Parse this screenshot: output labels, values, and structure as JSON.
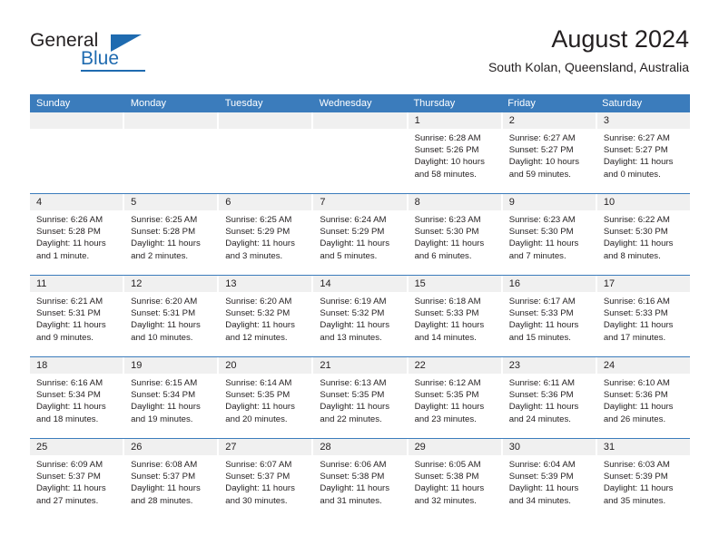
{
  "brand": {
    "name_top": "General",
    "name_bottom": "Blue"
  },
  "header": {
    "title": "August 2024",
    "subtitle": "South Kolan, Queensland, Australia"
  },
  "colors": {
    "header_blue": "#3b7cbc",
    "brand_blue": "#1f6bb0",
    "daynum_band": "#f0f0f0",
    "text": "#231f20"
  },
  "weekdays": [
    "Sunday",
    "Monday",
    "Tuesday",
    "Wednesday",
    "Thursday",
    "Friday",
    "Saturday"
  ],
  "labels": {
    "sunrise_prefix": "Sunrise:",
    "sunset_prefix": "Sunset:",
    "daylight_prefix": "Daylight:"
  },
  "weeks": [
    [
      {
        "day": "",
        "sunrise": "",
        "sunset": "",
        "daylight_line1": "",
        "daylight_line2": ""
      },
      {
        "day": "",
        "sunrise": "",
        "sunset": "",
        "daylight_line1": "",
        "daylight_line2": ""
      },
      {
        "day": "",
        "sunrise": "",
        "sunset": "",
        "daylight_line1": "",
        "daylight_line2": ""
      },
      {
        "day": "",
        "sunrise": "",
        "sunset": "",
        "daylight_line1": "",
        "daylight_line2": ""
      },
      {
        "day": "1",
        "sunrise": "Sunrise: 6:28 AM",
        "sunset": "Sunset: 5:26 PM",
        "daylight_line1": "Daylight: 10 hours",
        "daylight_line2": "and 58 minutes."
      },
      {
        "day": "2",
        "sunrise": "Sunrise: 6:27 AM",
        "sunset": "Sunset: 5:27 PM",
        "daylight_line1": "Daylight: 10 hours",
        "daylight_line2": "and 59 minutes."
      },
      {
        "day": "3",
        "sunrise": "Sunrise: 6:27 AM",
        "sunset": "Sunset: 5:27 PM",
        "daylight_line1": "Daylight: 11 hours",
        "daylight_line2": "and 0 minutes."
      }
    ],
    [
      {
        "day": "4",
        "sunrise": "Sunrise: 6:26 AM",
        "sunset": "Sunset: 5:28 PM",
        "daylight_line1": "Daylight: 11 hours",
        "daylight_line2": "and 1 minute."
      },
      {
        "day": "5",
        "sunrise": "Sunrise: 6:25 AM",
        "sunset": "Sunset: 5:28 PM",
        "daylight_line1": "Daylight: 11 hours",
        "daylight_line2": "and 2 minutes."
      },
      {
        "day": "6",
        "sunrise": "Sunrise: 6:25 AM",
        "sunset": "Sunset: 5:29 PM",
        "daylight_line1": "Daylight: 11 hours",
        "daylight_line2": "and 3 minutes."
      },
      {
        "day": "7",
        "sunrise": "Sunrise: 6:24 AM",
        "sunset": "Sunset: 5:29 PM",
        "daylight_line1": "Daylight: 11 hours",
        "daylight_line2": "and 5 minutes."
      },
      {
        "day": "8",
        "sunrise": "Sunrise: 6:23 AM",
        "sunset": "Sunset: 5:30 PM",
        "daylight_line1": "Daylight: 11 hours",
        "daylight_line2": "and 6 minutes."
      },
      {
        "day": "9",
        "sunrise": "Sunrise: 6:23 AM",
        "sunset": "Sunset: 5:30 PM",
        "daylight_line1": "Daylight: 11 hours",
        "daylight_line2": "and 7 minutes."
      },
      {
        "day": "10",
        "sunrise": "Sunrise: 6:22 AM",
        "sunset": "Sunset: 5:30 PM",
        "daylight_line1": "Daylight: 11 hours",
        "daylight_line2": "and 8 minutes."
      }
    ],
    [
      {
        "day": "11",
        "sunrise": "Sunrise: 6:21 AM",
        "sunset": "Sunset: 5:31 PM",
        "daylight_line1": "Daylight: 11 hours",
        "daylight_line2": "and 9 minutes."
      },
      {
        "day": "12",
        "sunrise": "Sunrise: 6:20 AM",
        "sunset": "Sunset: 5:31 PM",
        "daylight_line1": "Daylight: 11 hours",
        "daylight_line2": "and 10 minutes."
      },
      {
        "day": "13",
        "sunrise": "Sunrise: 6:20 AM",
        "sunset": "Sunset: 5:32 PM",
        "daylight_line1": "Daylight: 11 hours",
        "daylight_line2": "and 12 minutes."
      },
      {
        "day": "14",
        "sunrise": "Sunrise: 6:19 AM",
        "sunset": "Sunset: 5:32 PM",
        "daylight_line1": "Daylight: 11 hours",
        "daylight_line2": "and 13 minutes."
      },
      {
        "day": "15",
        "sunrise": "Sunrise: 6:18 AM",
        "sunset": "Sunset: 5:33 PM",
        "daylight_line1": "Daylight: 11 hours",
        "daylight_line2": "and 14 minutes."
      },
      {
        "day": "16",
        "sunrise": "Sunrise: 6:17 AM",
        "sunset": "Sunset: 5:33 PM",
        "daylight_line1": "Daylight: 11 hours",
        "daylight_line2": "and 15 minutes."
      },
      {
        "day": "17",
        "sunrise": "Sunrise: 6:16 AM",
        "sunset": "Sunset: 5:33 PM",
        "daylight_line1": "Daylight: 11 hours",
        "daylight_line2": "and 17 minutes."
      }
    ],
    [
      {
        "day": "18",
        "sunrise": "Sunrise: 6:16 AM",
        "sunset": "Sunset: 5:34 PM",
        "daylight_line1": "Daylight: 11 hours",
        "daylight_line2": "and 18 minutes."
      },
      {
        "day": "19",
        "sunrise": "Sunrise: 6:15 AM",
        "sunset": "Sunset: 5:34 PM",
        "daylight_line1": "Daylight: 11 hours",
        "daylight_line2": "and 19 minutes."
      },
      {
        "day": "20",
        "sunrise": "Sunrise: 6:14 AM",
        "sunset": "Sunset: 5:35 PM",
        "daylight_line1": "Daylight: 11 hours",
        "daylight_line2": "and 20 minutes."
      },
      {
        "day": "21",
        "sunrise": "Sunrise: 6:13 AM",
        "sunset": "Sunset: 5:35 PM",
        "daylight_line1": "Daylight: 11 hours",
        "daylight_line2": "and 22 minutes."
      },
      {
        "day": "22",
        "sunrise": "Sunrise: 6:12 AM",
        "sunset": "Sunset: 5:35 PM",
        "daylight_line1": "Daylight: 11 hours",
        "daylight_line2": "and 23 minutes."
      },
      {
        "day": "23",
        "sunrise": "Sunrise: 6:11 AM",
        "sunset": "Sunset: 5:36 PM",
        "daylight_line1": "Daylight: 11 hours",
        "daylight_line2": "and 24 minutes."
      },
      {
        "day": "24",
        "sunrise": "Sunrise: 6:10 AM",
        "sunset": "Sunset: 5:36 PM",
        "daylight_line1": "Daylight: 11 hours",
        "daylight_line2": "and 26 minutes."
      }
    ],
    [
      {
        "day": "25",
        "sunrise": "Sunrise: 6:09 AM",
        "sunset": "Sunset: 5:37 PM",
        "daylight_line1": "Daylight: 11 hours",
        "daylight_line2": "and 27 minutes."
      },
      {
        "day": "26",
        "sunrise": "Sunrise: 6:08 AM",
        "sunset": "Sunset: 5:37 PM",
        "daylight_line1": "Daylight: 11 hours",
        "daylight_line2": "and 28 minutes."
      },
      {
        "day": "27",
        "sunrise": "Sunrise: 6:07 AM",
        "sunset": "Sunset: 5:37 PM",
        "daylight_line1": "Daylight: 11 hours",
        "daylight_line2": "and 30 minutes."
      },
      {
        "day": "28",
        "sunrise": "Sunrise: 6:06 AM",
        "sunset": "Sunset: 5:38 PM",
        "daylight_line1": "Daylight: 11 hours",
        "daylight_line2": "and 31 minutes."
      },
      {
        "day": "29",
        "sunrise": "Sunrise: 6:05 AM",
        "sunset": "Sunset: 5:38 PM",
        "daylight_line1": "Daylight: 11 hours",
        "daylight_line2": "and 32 minutes."
      },
      {
        "day": "30",
        "sunrise": "Sunrise: 6:04 AM",
        "sunset": "Sunset: 5:39 PM",
        "daylight_line1": "Daylight: 11 hours",
        "daylight_line2": "and 34 minutes."
      },
      {
        "day": "31",
        "sunrise": "Sunrise: 6:03 AM",
        "sunset": "Sunset: 5:39 PM",
        "daylight_line1": "Daylight: 11 hours",
        "daylight_line2": "and 35 minutes."
      }
    ]
  ]
}
